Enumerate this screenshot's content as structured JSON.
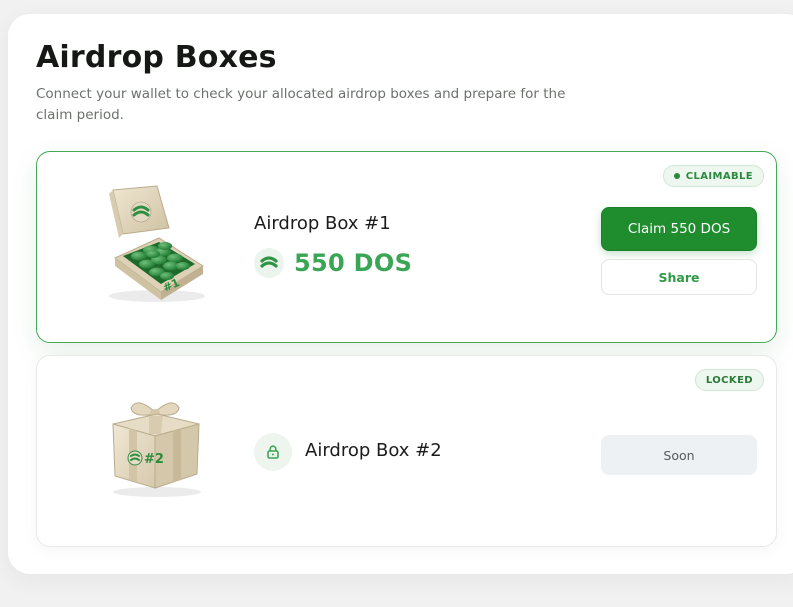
{
  "header": {
    "title": "Airdrop Boxes",
    "subtitle": "Connect your wallet to check your allocated airdrop boxes and prepare for the claim period."
  },
  "boxes": [
    {
      "name": "Airdrop Box #1",
      "status": "CLAIMABLE",
      "amount": "550 DOS",
      "box_number_label": "#1",
      "actions": {
        "claim_label": "Claim 550 DOS",
        "share_label": "Share"
      }
    },
    {
      "name": "Airdrop Box #2",
      "status": "LOCKED",
      "box_number_label": "#2",
      "actions": {
        "soon_label": "Soon"
      }
    }
  ],
  "icons": {
    "coin": "dos-coin-icon",
    "lock": "lock-icon"
  },
  "colors": {
    "accent": "#1f8d2e",
    "amount": "#3aa655",
    "status_bg": "#edf7ef"
  }
}
